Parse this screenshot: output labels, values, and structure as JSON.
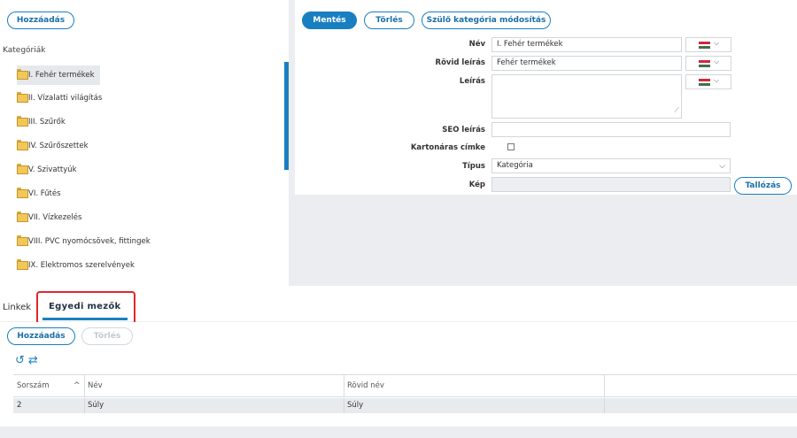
{
  "tree": {
    "add_label": "Hozzáadás",
    "title": "Kategóriák",
    "items": [
      {
        "label": "I. Fehér termékek"
      },
      {
        "label": "II. Vízalatti világítás"
      },
      {
        "label": "III. Szűrők"
      },
      {
        "label": "IV. Szűrőszettek"
      },
      {
        "label": "V. Szivattyúk"
      },
      {
        "label": "VI. Fűtés"
      },
      {
        "label": "VII. Vízkezelés"
      },
      {
        "label": "VIII. PVC nyomócsövek, fittingek"
      },
      {
        "label": "IX. Elektromos szerelvények"
      }
    ]
  },
  "form": {
    "save_label": "Mentés",
    "delete_label": "Törlés",
    "parent_modify_label": "Szülő kategória módosítás",
    "name_label": "Név",
    "name_value": "I. Fehér termékek",
    "short_desc_label": "Rövid leírás",
    "short_desc_value": "Fehér termékek",
    "desc_label": "Leírás",
    "desc_value": "",
    "seo_label": "SEO leírás",
    "seo_value": "",
    "carton_label": "Kartonáras címke",
    "type_label": "Típus",
    "type_value": "Kategória",
    "image_label": "Kép",
    "browse_label": "Tallózás",
    "flag_colors": [
      "#cd2a3e",
      "#ffffff",
      "#436f4d"
    ]
  },
  "tabs": {
    "links_label": "Linkek",
    "custom_label": "Egyedi mezők"
  },
  "grid": {
    "add_label": "Hozzáadás",
    "delete_label": "Törlés",
    "columns": {
      "order": "Sorszám",
      "name": "Név",
      "short_name": "Rövid név"
    },
    "rows": [
      {
        "order": "2",
        "name": "Súly",
        "short_name": "Súly"
      }
    ]
  }
}
